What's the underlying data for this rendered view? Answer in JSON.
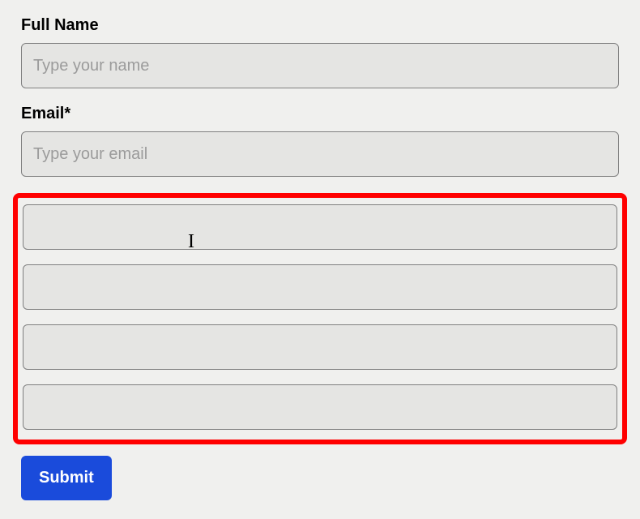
{
  "form": {
    "full_name": {
      "label": "Full Name",
      "placeholder": "Type your name",
      "value": ""
    },
    "email": {
      "label": "Email*",
      "placeholder": "Type your email",
      "value": ""
    },
    "extra_fields": [
      {
        "value": ""
      },
      {
        "value": ""
      },
      {
        "value": ""
      },
      {
        "value": ""
      }
    ],
    "submit_label": "Submit"
  }
}
